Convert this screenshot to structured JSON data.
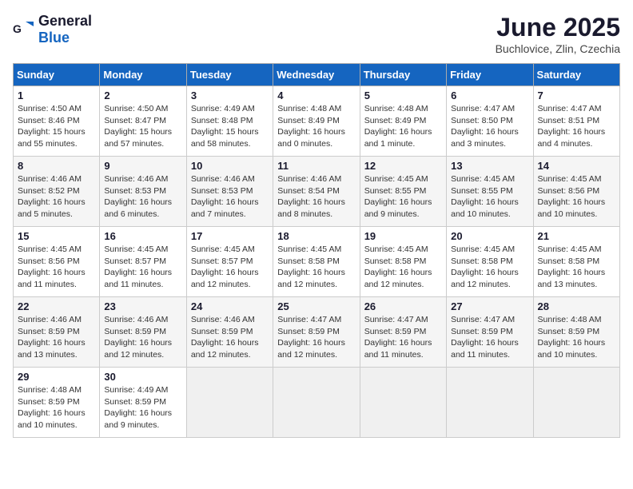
{
  "header": {
    "logo_general": "General",
    "logo_blue": "Blue",
    "month_title": "June 2025",
    "location": "Buchlovice, Zlin, Czechia"
  },
  "weekdays": [
    "Sunday",
    "Monday",
    "Tuesday",
    "Wednesday",
    "Thursday",
    "Friday",
    "Saturday"
  ],
  "weeks": [
    [
      {
        "day": "1",
        "sunrise": "4:50 AM",
        "sunset": "8:46 PM",
        "daylight": "15 hours and 55 minutes."
      },
      {
        "day": "2",
        "sunrise": "4:50 AM",
        "sunset": "8:47 PM",
        "daylight": "15 hours and 57 minutes."
      },
      {
        "day": "3",
        "sunrise": "4:49 AM",
        "sunset": "8:48 PM",
        "daylight": "15 hours and 58 minutes."
      },
      {
        "day": "4",
        "sunrise": "4:48 AM",
        "sunset": "8:49 PM",
        "daylight": "16 hours and 0 minutes."
      },
      {
        "day": "5",
        "sunrise": "4:48 AM",
        "sunset": "8:49 PM",
        "daylight": "16 hours and 1 minute."
      },
      {
        "day": "6",
        "sunrise": "4:47 AM",
        "sunset": "8:50 PM",
        "daylight": "16 hours and 3 minutes."
      },
      {
        "day": "7",
        "sunrise": "4:47 AM",
        "sunset": "8:51 PM",
        "daylight": "16 hours and 4 minutes."
      }
    ],
    [
      {
        "day": "8",
        "sunrise": "4:46 AM",
        "sunset": "8:52 PM",
        "daylight": "16 hours and 5 minutes."
      },
      {
        "day": "9",
        "sunrise": "4:46 AM",
        "sunset": "8:53 PM",
        "daylight": "16 hours and 6 minutes."
      },
      {
        "day": "10",
        "sunrise": "4:46 AM",
        "sunset": "8:53 PM",
        "daylight": "16 hours and 7 minutes."
      },
      {
        "day": "11",
        "sunrise": "4:46 AM",
        "sunset": "8:54 PM",
        "daylight": "16 hours and 8 minutes."
      },
      {
        "day": "12",
        "sunrise": "4:45 AM",
        "sunset": "8:55 PM",
        "daylight": "16 hours and 9 minutes."
      },
      {
        "day": "13",
        "sunrise": "4:45 AM",
        "sunset": "8:55 PM",
        "daylight": "16 hours and 10 minutes."
      },
      {
        "day": "14",
        "sunrise": "4:45 AM",
        "sunset": "8:56 PM",
        "daylight": "16 hours and 10 minutes."
      }
    ],
    [
      {
        "day": "15",
        "sunrise": "4:45 AM",
        "sunset": "8:56 PM",
        "daylight": "16 hours and 11 minutes."
      },
      {
        "day": "16",
        "sunrise": "4:45 AM",
        "sunset": "8:57 PM",
        "daylight": "16 hours and 11 minutes."
      },
      {
        "day": "17",
        "sunrise": "4:45 AM",
        "sunset": "8:57 PM",
        "daylight": "16 hours and 12 minutes."
      },
      {
        "day": "18",
        "sunrise": "4:45 AM",
        "sunset": "8:58 PM",
        "daylight": "16 hours and 12 minutes."
      },
      {
        "day": "19",
        "sunrise": "4:45 AM",
        "sunset": "8:58 PM",
        "daylight": "16 hours and 12 minutes."
      },
      {
        "day": "20",
        "sunrise": "4:45 AM",
        "sunset": "8:58 PM",
        "daylight": "16 hours and 12 minutes."
      },
      {
        "day": "21",
        "sunrise": "4:45 AM",
        "sunset": "8:58 PM",
        "daylight": "16 hours and 13 minutes."
      }
    ],
    [
      {
        "day": "22",
        "sunrise": "4:46 AM",
        "sunset": "8:59 PM",
        "daylight": "16 hours and 13 minutes."
      },
      {
        "day": "23",
        "sunrise": "4:46 AM",
        "sunset": "8:59 PM",
        "daylight": "16 hours and 12 minutes."
      },
      {
        "day": "24",
        "sunrise": "4:46 AM",
        "sunset": "8:59 PM",
        "daylight": "16 hours and 12 minutes."
      },
      {
        "day": "25",
        "sunrise": "4:47 AM",
        "sunset": "8:59 PM",
        "daylight": "16 hours and 12 minutes."
      },
      {
        "day": "26",
        "sunrise": "4:47 AM",
        "sunset": "8:59 PM",
        "daylight": "16 hours and 11 minutes."
      },
      {
        "day": "27",
        "sunrise": "4:47 AM",
        "sunset": "8:59 PM",
        "daylight": "16 hours and 11 minutes."
      },
      {
        "day": "28",
        "sunrise": "4:48 AM",
        "sunset": "8:59 PM",
        "daylight": "16 hours and 10 minutes."
      }
    ],
    [
      {
        "day": "29",
        "sunrise": "4:48 AM",
        "sunset": "8:59 PM",
        "daylight": "16 hours and 10 minutes."
      },
      {
        "day": "30",
        "sunrise": "4:49 AM",
        "sunset": "8:59 PM",
        "daylight": "16 hours and 9 minutes."
      },
      null,
      null,
      null,
      null,
      null
    ]
  ]
}
